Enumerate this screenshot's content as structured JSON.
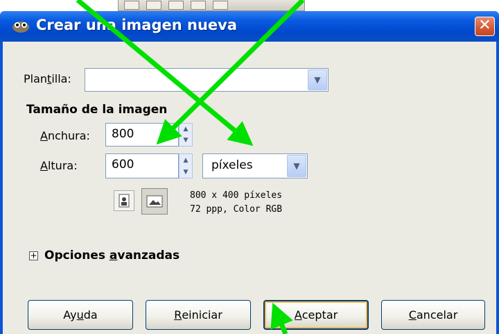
{
  "dialog": {
    "title": "Crear una imagen nueva",
    "close_symbol": "✕"
  },
  "template": {
    "label": "Plantilla:",
    "value": ""
  },
  "image_size": {
    "heading": "Tamaño de la imagen",
    "width_label": "Anchura:",
    "width_value": "800",
    "height_label": "Altura:",
    "height_value": "600",
    "unit": "píxeles",
    "info_line1": "800 x 400 píxeles",
    "info_line2": "72 ppp, Color RGB"
  },
  "advanced": {
    "label": "Opciones avanzadas",
    "expander_symbol": "+"
  },
  "buttons": {
    "help": "Ayuda",
    "reset": "Reiniciar",
    "ok": "Aceptar",
    "cancel": "Cancelar"
  },
  "annotations": {
    "arrow_color": "#00e000"
  }
}
